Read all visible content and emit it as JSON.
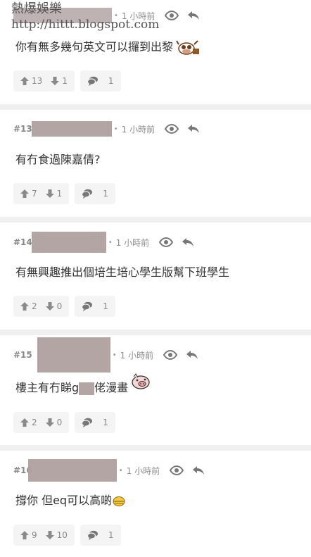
{
  "watermark": {
    "title": "熱爆娛樂",
    "url": "http://hittt.blogspot.com"
  },
  "posts": [
    {
      "number": "",
      "dot": "•",
      "time": "1 小時前",
      "content": "你有無多幾句英文可以攞到出黎",
      "up": "13",
      "down": "1",
      "comments": "1"
    },
    {
      "number": "#13",
      "dot": "•",
      "time": "1 小時前",
      "content": "有冇食過陳嘉倩?",
      "up": "7",
      "down": "1",
      "comments": "1"
    },
    {
      "number": "#14",
      "dot": "•",
      "time": "1 小時前",
      "content": "有無興趣推出個培生培心學生版幫下班學生",
      "up": "2",
      "down": "0",
      "comments": "1"
    },
    {
      "number": "#15",
      "dot": "•",
      "time": "1 小時前",
      "content_a": "樓主有冇睇g",
      "content_b": "佬漫畫",
      "up": "2",
      "down": "0",
      "comments": "1"
    },
    {
      "number": "#16",
      "dot": "•",
      "time": "1 小時前",
      "content": "撐你 但eq可以高啲",
      "up": "9",
      "down": "10",
      "comments": "1"
    }
  ],
  "icons": {
    "view": "eye-icon",
    "reply": "reply-arrow-icon",
    "up": "arrow-up-icon",
    "down": "arrow-down-icon",
    "comment": "comment-bubble-icon"
  },
  "colors": {
    "separator": "#f0f0f0",
    "button_bg": "#f4f4f4",
    "text": "#333333",
    "meta": "#8c8c8c",
    "mask": "#b0a0a0"
  }
}
